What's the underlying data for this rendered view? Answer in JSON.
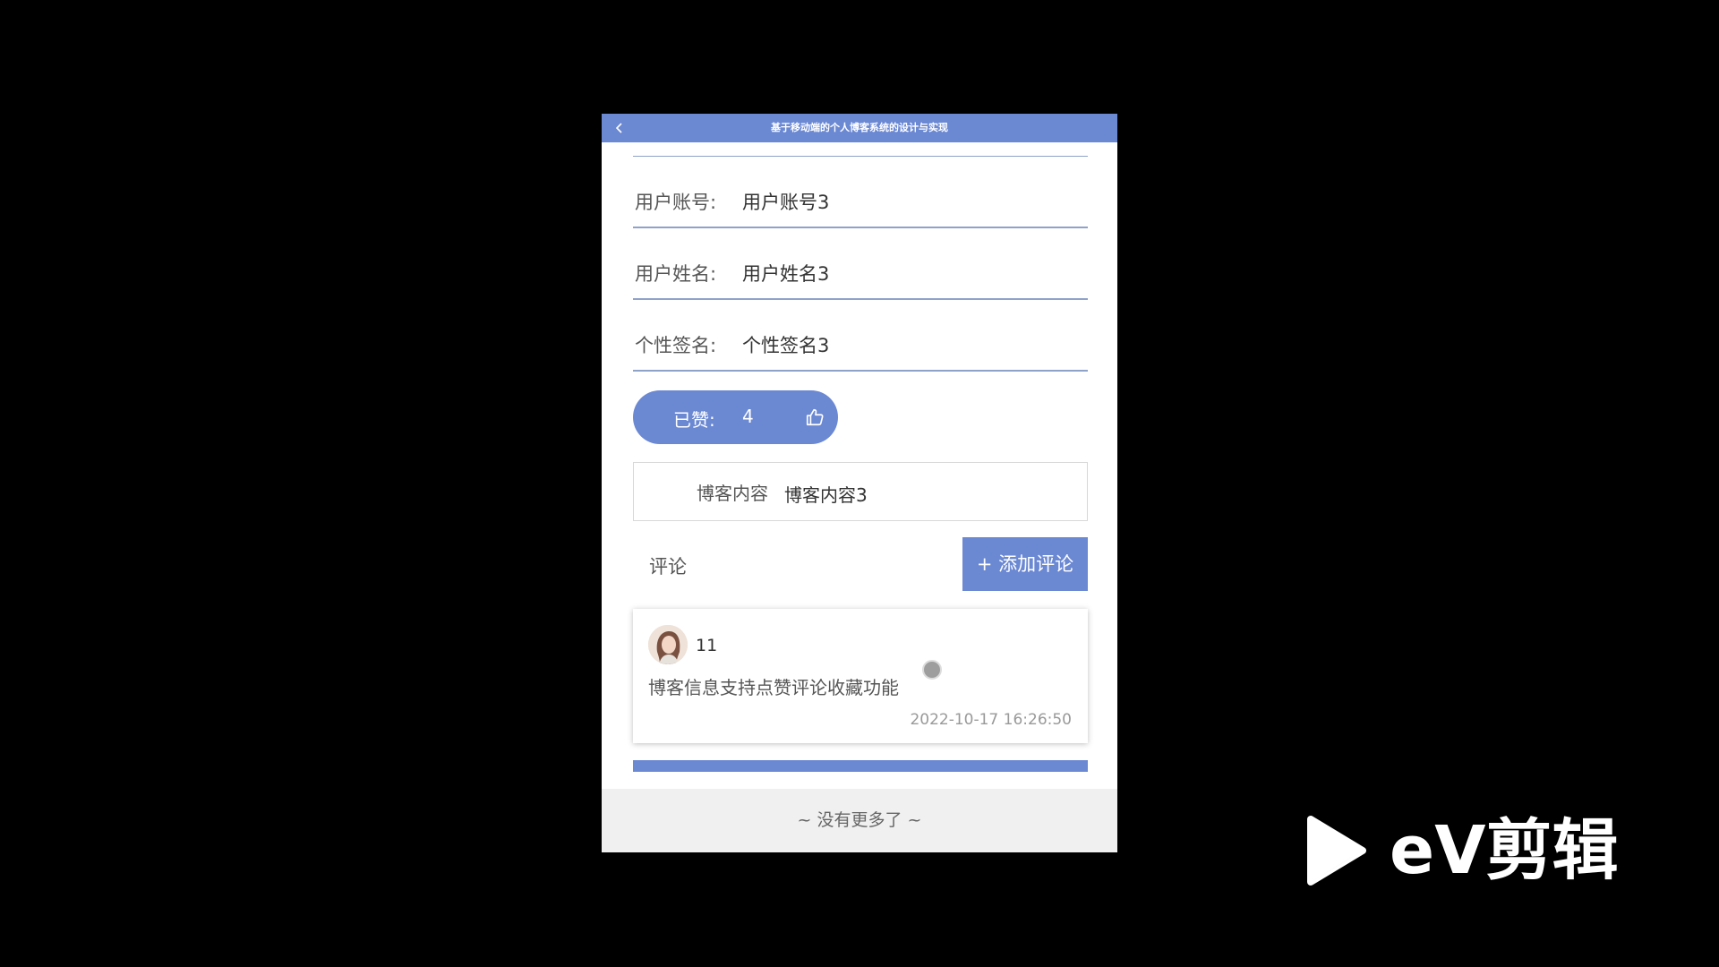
{
  "app": {
    "title": "基于移动端的个人博客系统的设计与实现"
  },
  "fields": [
    {
      "label": "用户账号:",
      "value": "用户账号3"
    },
    {
      "label": "用户姓名:",
      "value": "用户姓名3"
    },
    {
      "label": "个性签名:",
      "value": "个性签名3"
    }
  ],
  "like": {
    "label": "已赞:",
    "count": "4",
    "icon": "thumbs-up-icon"
  },
  "blog": {
    "label": "博客内容",
    "value": "博客内容3"
  },
  "comments": {
    "title": "评论",
    "add_label": "+ 添加评论",
    "items": [
      {
        "user": "11",
        "text": "博客信息支持点赞评论收藏功能",
        "time": "2022-10-17 16:26:50"
      }
    ]
  },
  "footer": {
    "no_more": "~ 没有更多了 ~"
  },
  "watermark": {
    "text": "eV剪辑"
  },
  "colors": {
    "accent": "#6b88d3",
    "background": "#000000",
    "card": "#ffffff"
  }
}
